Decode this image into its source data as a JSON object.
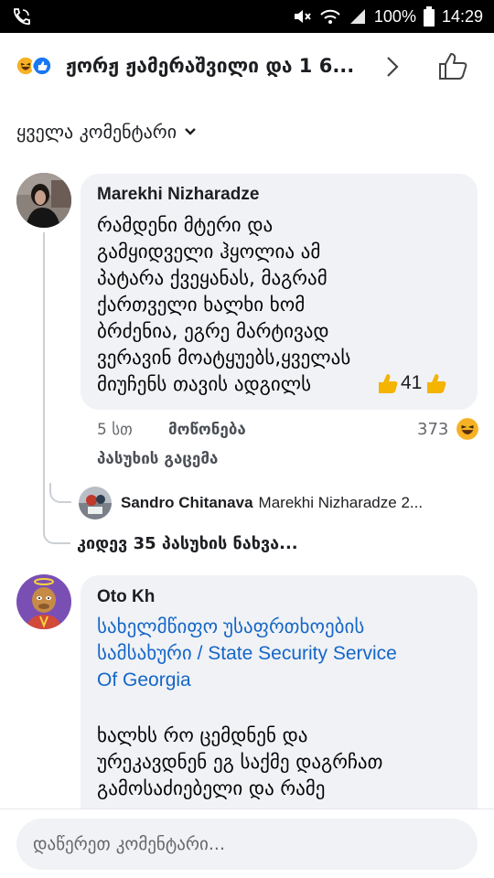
{
  "status_bar": {
    "battery": "100%",
    "time": "14:29"
  },
  "reactions": {
    "summary": "ჟორჟ ჟამერაშვილი და 1 6..."
  },
  "filter": {
    "label": "ყველა კომენტარი"
  },
  "comments": [
    {
      "author": "Marekhi Nizharadze",
      "text": "რამდენი მტერი და\nგამყიდველი ჰყოლია ამ\nპატარა ქვეყანას, მაგრამ\nქართველი ხალხი ხომ\nბრძენია, ეგრე მარტივად\nვერავინ მოატყუებს,ყველას\nმიუჩენს თავის ადგილს",
      "text_tail": "41",
      "time": "5 სთ",
      "like_label": "მოწონება",
      "reply_label": "პასუხის გაცემა",
      "reaction_count": "373",
      "reply_preview": {
        "author": "Sandro Chitanava",
        "text": "Marekhi Nizharadze 2..."
      },
      "more_replies": "კიდევ 35 პასუხის ნახვა..."
    },
    {
      "author": "Oto Kh",
      "link_text": "სახელმწიფო უსაფრთხოების\nსამსახური / State Security Service\nOf Georgia",
      "text": "ხალხს რო ცემდნენ და\nურეკავდნენ ეგ საქმე დაგრჩათ\nგამოსაძიებელი და რამე"
    }
  ],
  "composer": {
    "placeholder": "დაწერეთ კომენტარი..."
  }
}
